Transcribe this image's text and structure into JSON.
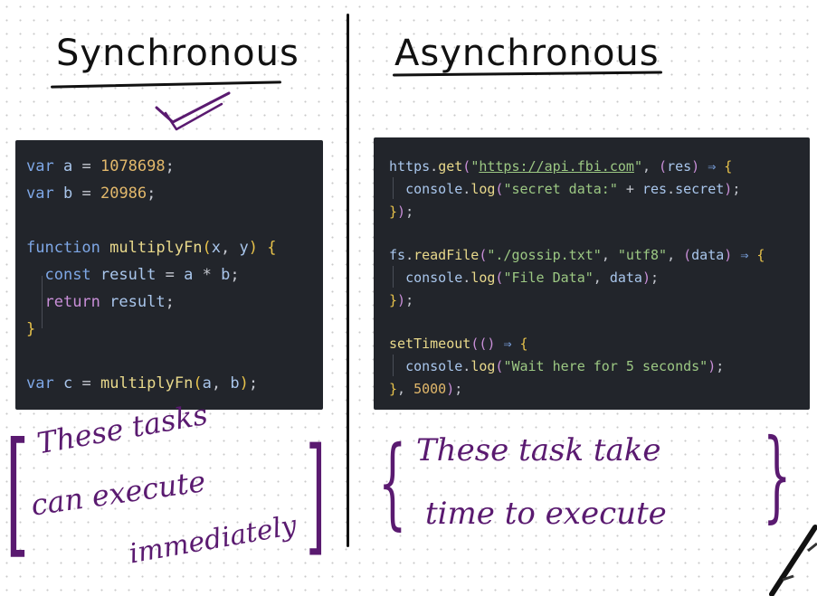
{
  "left": {
    "heading": "Synchronous",
    "code_lines": [
      "var a = 1078698;",
      "var b = 20986;",
      "",
      "function multiplyFn(x, y) {",
      "  const result = a * b;",
      "  return result;",
      "}",
      "",
      "var c = multiplyFn(a, b);"
    ],
    "note_lines": [
      "These tasks",
      "can execute",
      "immediately"
    ]
  },
  "right": {
    "heading": "Asynchronous",
    "code_lines": [
      "https.get(\"https://api.fbi.com\", (res) ⇒ {",
      "  console.log(\"secret data:\" + res.secret);",
      "});",
      "",
      "fs.readFile(\"./gossip.txt\", \"utf8\", (data) ⇒ {",
      "  console.log(\"File Data\", data);",
      "});",
      "",
      "setTimeout(() ⇒ {",
      "  console.log(\"Wait here for 5 seconds\");",
      "}, 5000);"
    ],
    "note_lines": [
      "These task take",
      "time to execute"
    ]
  },
  "colors": {
    "ink": "#111111",
    "annotation": "#5a1a70",
    "code_background": "#22252b"
  }
}
